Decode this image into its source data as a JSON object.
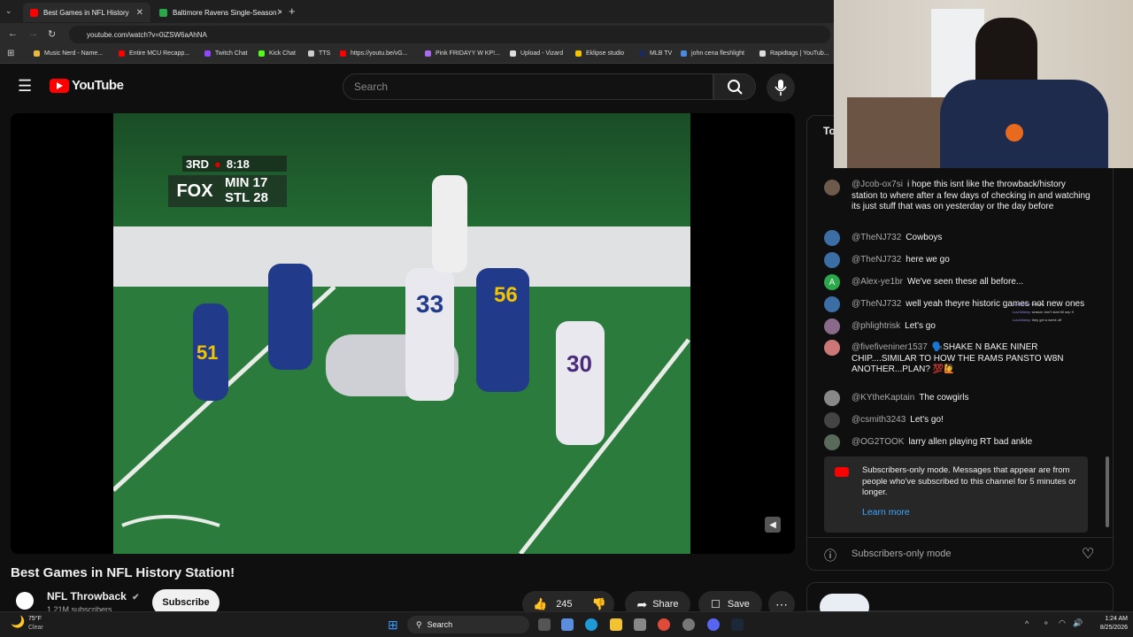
{
  "browser": {
    "tabs": [
      {
        "label": "Best Games in NFL History",
        "active": true
      },
      {
        "label": "Baltimore Ravens Single-Season",
        "active": false
      }
    ],
    "url": "youtube.com/watch?v=0iZSW6aAhNA",
    "bookmarks": [
      "Music Nerd - Name...",
      "Entire MCU Recapp...",
      "Twitch Chat",
      "Kick Chat",
      "TTS",
      "https://youtu.be/vG...",
      "Pink FRIDAYY W KP!...",
      "Upload - Vizard",
      "Eklipse studio",
      "MLB TV",
      "john cena fleshlight",
      "Rapidtags | YouTub..."
    ]
  },
  "youtube": {
    "logo": "YouTube",
    "search_placeholder": "Search"
  },
  "video": {
    "score_quarter": "3RD",
    "score_clock": "8:18",
    "score_network": "FOX",
    "team1": "MIN 17",
    "team2": "STL 28",
    "jersey_numbers": [
      "51",
      "33",
      "56",
      "30"
    ]
  },
  "below": {
    "title": "Best Games in NFL History Station!",
    "channel": "NFL Throwback",
    "subscribers": "1.21M subscribers",
    "subscribe_label": "Subscribe",
    "likes": "245",
    "share_label": "Share",
    "save_label": "Save"
  },
  "chat": {
    "header": "To",
    "messages": [
      {
        "user": "@Jcob-ox7si",
        "text": "i hope this isnt like the throwback/history station to where after a few days of checking in and watching its just stuff that was on yesterday or the day before"
      },
      {
        "user": "@TheNJ732",
        "text": "Cowboys"
      },
      {
        "user": "@TheNJ732",
        "text": "here we go"
      },
      {
        "user": "@Alex-ye1br",
        "text": "We've seen these all before..."
      },
      {
        "user": "@TheNJ732",
        "text": "well yeah theyre historic games not new ones"
      },
      {
        "user": "@phlightrisk",
        "text": "Let's go"
      },
      {
        "user": "@fivefiveniner1537",
        "text": "🗣️SHAKE N BAKE NINER CHIP....SIMILAR TO HOW THE RAMS PANSTO W8N ANOTHER...PLAN? 💯🙋"
      },
      {
        "user": "@KYtheKaptain",
        "text": "The cowgirls"
      },
      {
        "user": "@csmith3243",
        "text": "Let's go!"
      },
      {
        "user": "@OG2TOOK",
        "text": "larry allen playing RT bad ankle"
      }
    ],
    "avatar_letter": "A",
    "banner_text": "Subscribers-only mode. Messages that appear are from people who've subscribed to this channel for 5 minutes or longer.",
    "learn_more": "Learn more",
    "input_placeholder": "Subscribers-only mode"
  },
  "overlay_chat": [
    {
      "user": "LuvJohnny",
      "text": "tuesday"
    },
    {
      "user": "LuvJohnny",
      "text": "season don't start till sep 9"
    },
    {
      "user": "LuvJohnny",
      "text": "they get a week off"
    }
  ],
  "taskbar": {
    "weather_temp": "75°F",
    "weather_desc": "Clear",
    "search": "Search",
    "time": "1:24 AM",
    "date": "8/25/2026"
  }
}
